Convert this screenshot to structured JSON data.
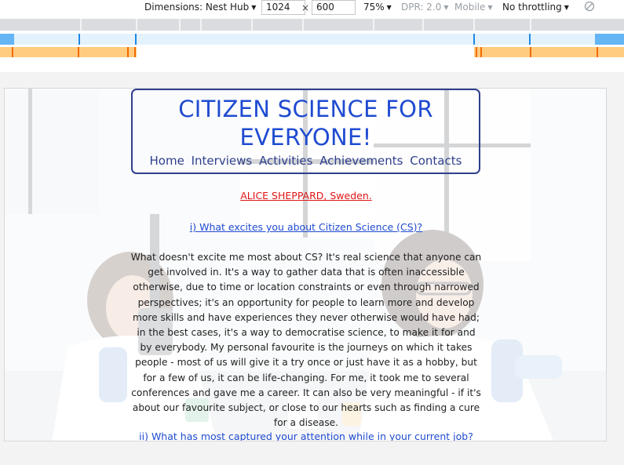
{
  "devtools": {
    "dimensions_label": "Dimensions: Nest Hub",
    "width_value": "1024",
    "times_sign": "×",
    "height_value": "600",
    "zoom": "75%",
    "dpr": "DPR: 2.0",
    "device_type": "Mobile",
    "throttling": "No throttling",
    "caret": "▼"
  },
  "colors": {
    "title_blue": "#1f4bd1",
    "nav_navy": "#2e3f8c",
    "name_red": "#e01515",
    "mq_blue": "#64b5f6",
    "mq_orange": "#ffcc80"
  },
  "site": {
    "title": "CITIZEN SCIENCE FOR EVERYONE!",
    "nav": [
      "Home",
      "Interviews",
      "Activities",
      "Achievements",
      "Contacts"
    ]
  },
  "article": {
    "person": "ALICE SHEPPARD, Sweden.",
    "q1": "i) What excites you about Citizen Science (CS)?",
    "a1": "What doesn't excite me most about CS? It's real science that anyone can get involved in. It's a way to gather data that is often inaccessible otherwise, due to time or location constraints or even through narrowed perspectives; it's an opportunity for people to learn more and develop more skills and have experiences they never otherwise would have had; in the best cases, it's a way to democratise science, to make it for and by everybody. My personal favourite is the journeys on which it takes people - most of us will give it a try once or just have it as a hobby, but for a few of us, it can be life-changing. For me, it took me to several conferences and gave me a career. It can also be very meaningful - if it's about our favourite subject, or close to our hearts such as finding a cure for a disease.",
    "q2": "ii) What has most captured your attention while in your current job?"
  }
}
